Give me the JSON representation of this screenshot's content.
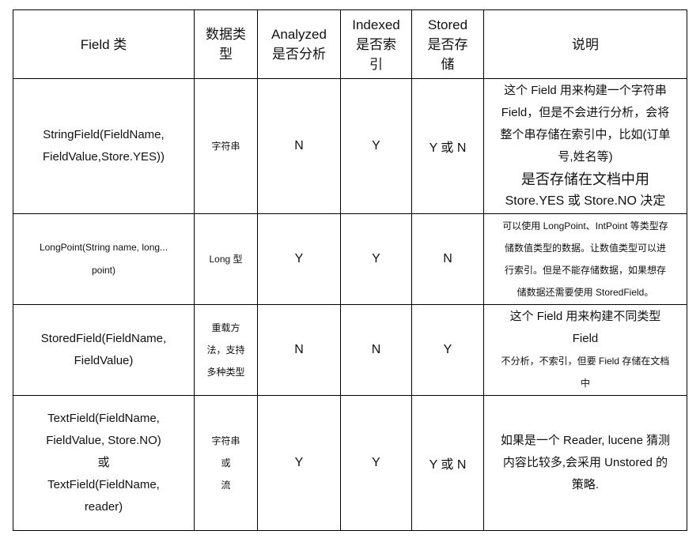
{
  "headers": {
    "field_class": "Field 类",
    "data_type": "数据类型",
    "analyzed_1": "Analyzed",
    "analyzed_2": "是否分析",
    "indexed_1": "Indexed",
    "indexed_2": "是否索",
    "indexed_3": "引",
    "stored_1": "Stored",
    "stored_2": "是否存",
    "stored_3": "储",
    "desc": "说明"
  },
  "rows": [
    {
      "field_lines": [
        "StringField(FieldName,",
        "FieldValue,Store.YES))"
      ],
      "type_lines": [
        "字符串"
      ],
      "analyzed": "N",
      "indexed": "Y",
      "stored": "Y 或 N",
      "desc_lines": [
        "这个 Field 用来构建一个字符串",
        "Field，但是不会进行分析，会将",
        "整个串存储在索引中，比如(订单",
        "号,姓名等)"
      ],
      "desc_big_lines": [
        "是否存储在文档中用",
        "Store.YES 或 Store.NO 决定"
      ]
    },
    {
      "field_lines": [
        "LongPoint(String name, long...",
        "point)"
      ],
      "type_lines": [
        "Long 型"
      ],
      "analyzed": "Y",
      "indexed": "Y",
      "stored": "N",
      "desc_lines": [
        "可以使用 LongPoint、IntPoint 等类型存",
        "储数值类型的数据。让数值类型可以进",
        "行索引。但是不能存储数据，如果想存",
        "储数据还需要使用 StoredField。"
      ]
    },
    {
      "field_lines": [
        "StoredField(FieldName,",
        "FieldValue)"
      ],
      "type_lines": [
        "重载方",
        "法，支持",
        "多种类型"
      ],
      "analyzed": "N",
      "indexed": "N",
      "stored": "Y",
      "desc_lines": [
        "这个 Field 用来构建不同类型",
        "Field"
      ],
      "desc_small_lines": [
        "不分析，不索引，但要 Field 存储在文档",
        "中"
      ]
    },
    {
      "field_lines": [
        "TextField(FieldName,",
        "FieldValue, Store.NO)",
        "或",
        "TextField(FieldName,",
        "reader)"
      ],
      "type_lines": [
        "字符串",
        "或",
        "流"
      ],
      "analyzed": "Y",
      "indexed": "Y",
      "stored": "Y 或 N",
      "desc_lines": [
        "如果是一个 Reader, lucene 猜测",
        "内容比较多,会采用 Unstored 的",
        "策略."
      ]
    }
  ]
}
